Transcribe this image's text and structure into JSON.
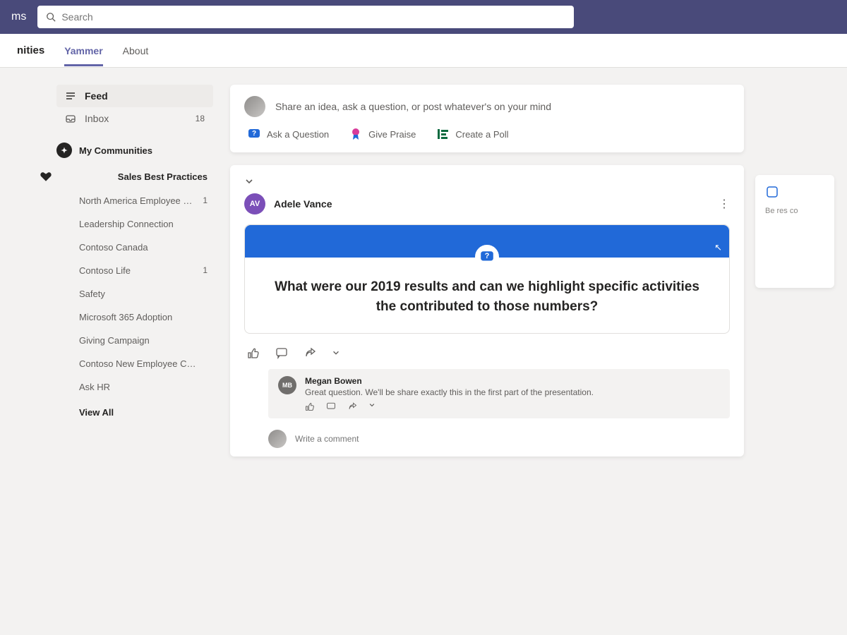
{
  "topbar": {
    "app_name": "ms",
    "search_placeholder": "Search"
  },
  "tabs": {
    "title": "nities",
    "items": [
      "Yammer",
      "About"
    ],
    "active_index": 0
  },
  "sidebar": {
    "nav": [
      {
        "icon": "feed",
        "label": "Feed",
        "count": "",
        "selected": true
      },
      {
        "icon": "inbox",
        "label": "Inbox",
        "count": "18",
        "selected": false
      }
    ],
    "section_title": "My Communities",
    "current_community": "Sales Best Practices",
    "communities": [
      {
        "label": "North America Employee …",
        "count": "1"
      },
      {
        "label": "Leadership Connection",
        "count": ""
      },
      {
        "label": "Contoso Canada",
        "count": ""
      },
      {
        "label": "Contoso Life",
        "count": "1"
      },
      {
        "label": "Safety",
        "count": ""
      },
      {
        "label": "Microsoft 365 Adoption",
        "count": ""
      },
      {
        "label": "Giving Campaign",
        "count": ""
      },
      {
        "label": "Contoso New Employee C…",
        "count": ""
      },
      {
        "label": "Ask HR",
        "count": ""
      }
    ],
    "view_all": "View All"
  },
  "composer": {
    "prompt": "Share an idea, ask a question, or post whatever's on your mind",
    "actions": {
      "ask": "Ask a Question",
      "praise": "Give Praise",
      "poll": "Create a Poll"
    }
  },
  "post": {
    "author_initials": "AV",
    "author_name": "Adele Vance",
    "question": "What were our 2019 results and can we highlight specific activities the contributed to those numbers?",
    "reply": {
      "initials": "MB",
      "name": "Megan Bowen",
      "text": "Great question. We'll be share exactly this in the first part of the presentation."
    },
    "write_placeholder": "Write a comment"
  },
  "right_panel": {
    "text": "Be res co"
  }
}
